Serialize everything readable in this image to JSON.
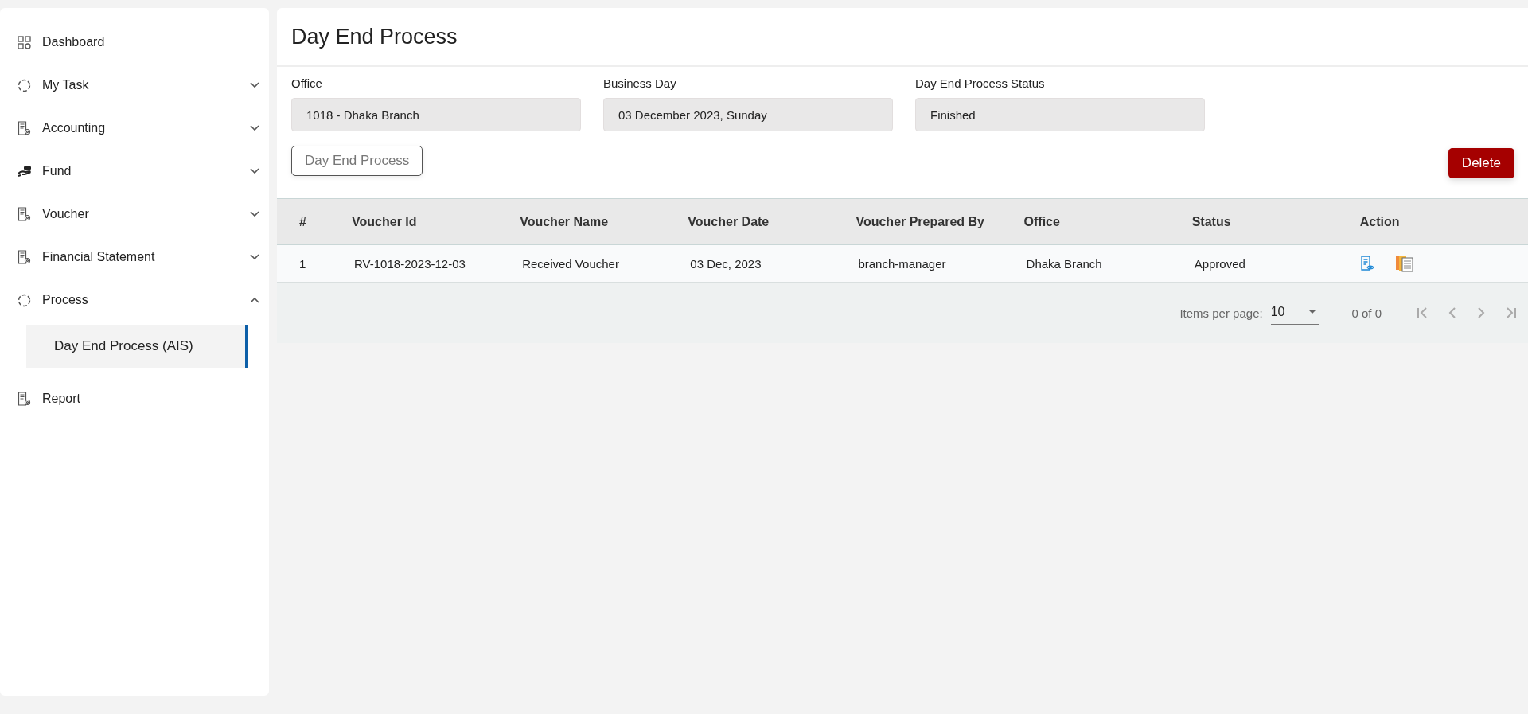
{
  "sidebar": {
    "items": [
      {
        "label": "Dashboard",
        "kind": "grid"
      },
      {
        "label": "My Task",
        "kind": "ring",
        "expanded": false
      },
      {
        "label": "Accounting",
        "kind": "document",
        "expanded": false
      },
      {
        "label": "Fund",
        "kind": "hand",
        "expanded": false
      },
      {
        "label": "Voucher",
        "kind": "document",
        "expanded": false
      },
      {
        "label": "Financial Statement",
        "kind": "document",
        "expanded": false
      },
      {
        "label": "Process",
        "kind": "ring",
        "expanded": true,
        "children": [
          {
            "label": "Day End Process (AIS)",
            "selected": true
          }
        ]
      },
      {
        "label": "Report",
        "kind": "document"
      }
    ]
  },
  "page": {
    "title": "Day End Process",
    "fields": [
      {
        "label": "Office",
        "value": "1018 - Dhaka Branch"
      },
      {
        "label": "Business Day",
        "value": "03 December 2023, Sunday"
      },
      {
        "label": "Day End Process Status",
        "value": "Finished"
      }
    ],
    "process_button": "Day End Process",
    "delete_button": "Delete"
  },
  "table": {
    "columns": [
      "#",
      "Voucher Id",
      "Voucher Name",
      "Voucher Date",
      "Voucher Prepared By",
      "Office",
      "Status",
      "Action"
    ],
    "rows": [
      {
        "cells": [
          "1",
          "RV-1018-2023-12-03",
          "Received Voucher",
          "03 Dec, 2023",
          "branch-manager",
          "Dhaka Branch",
          "Approved"
        ]
      }
    ]
  },
  "paginator": {
    "label": "Items per page:",
    "page_size": "10",
    "range": "0 of 0"
  }
}
